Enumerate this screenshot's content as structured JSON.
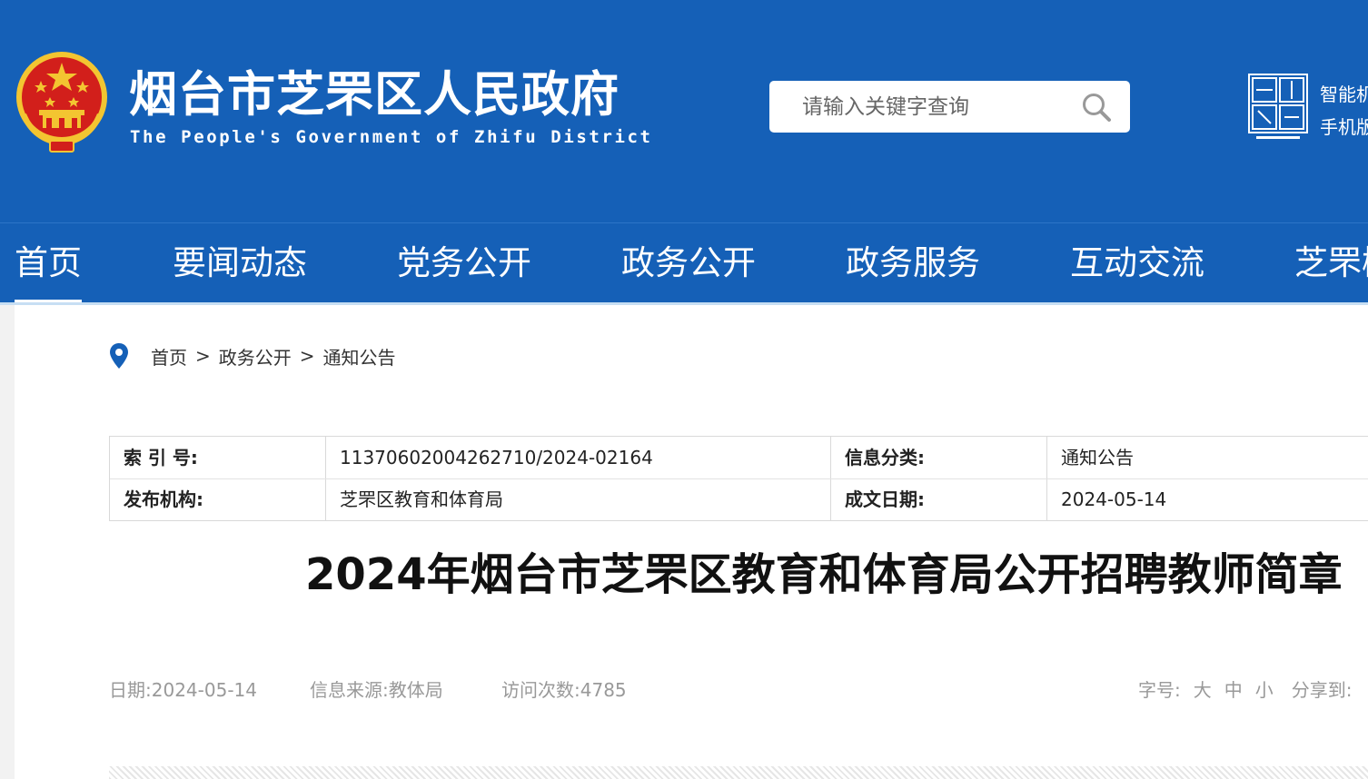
{
  "header": {
    "title": "烟台市芝罘区人民政府",
    "subtitle": "The People's Government of Zhifu District",
    "search_placeholder": "请输入关键字查询",
    "mobile_links": [
      "智能机",
      "手机版"
    ]
  },
  "nav": {
    "items": [
      "首页",
      "要闻动态",
      "党务公开",
      "政务公开",
      "政务服务",
      "互动交流",
      "芝罘概况"
    ],
    "active_index": 0
  },
  "breadcrumb": {
    "items": [
      "首页",
      "政务公开",
      "通知公告"
    ],
    "separator": ">"
  },
  "meta": {
    "index_label": "索 引 号:",
    "index_value": "11370602004262710/2024-02164",
    "category_label": "信息分类:",
    "category_value": "通知公告",
    "publisher_label": "发布机构:",
    "publisher_value": "芝罘区教育和体育局",
    "date_label": "成文日期:",
    "date_value": "2024-05-14"
  },
  "article": {
    "title": "2024年烟台市芝罘区教育和体育局公开招聘教师简章",
    "date_label": "日期:",
    "date": "2024-05-14",
    "source_label": "信息来源:",
    "source": "教体局",
    "visits_label": "访问次数:",
    "visits": "4785",
    "font_size_label": "字号:",
    "font_sizes": [
      "大",
      "中",
      "小"
    ],
    "share_label": "分享到:"
  },
  "colors": {
    "header_blue": "#1560b7",
    "background": "#f2f2f2",
    "emblem_red": "#d21f1b",
    "emblem_gold": "#f3c531"
  },
  "icons": {
    "emblem": "national-emblem-icon",
    "search": "search-icon",
    "qr": "yantai-china-logo-icon",
    "pin": "location-pin-icon"
  }
}
